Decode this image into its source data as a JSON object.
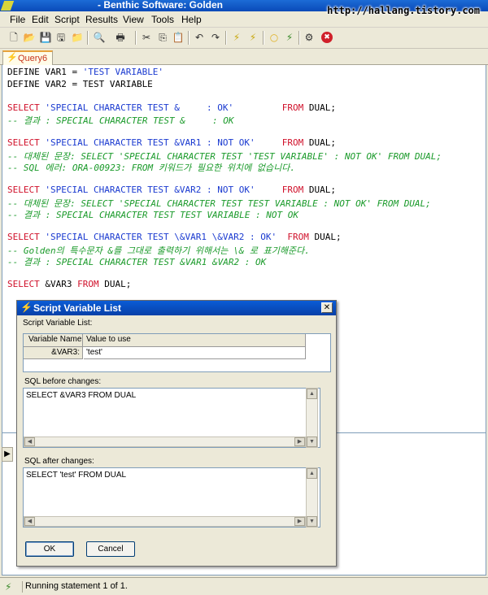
{
  "window": {
    "title": "- Benthic Software: Golden"
  },
  "watermark": "http://hallang.tistory.com",
  "menu": [
    "File",
    "Edit",
    "Script",
    "Results",
    "View",
    "Tools",
    "Help"
  ],
  "toolbar": {
    "buttons": [
      {
        "name": "new-icon",
        "glyph": "🗋"
      },
      {
        "name": "open-icon",
        "glyph": "📂"
      },
      {
        "name": "save-icon",
        "glyph": "💾"
      },
      {
        "name": "save-all-icon",
        "glyph": "🖫"
      },
      {
        "name": "open-folder-icon",
        "glyph": "📁"
      },
      {
        "name": "print-preview-icon",
        "glyph": "🔍"
      },
      {
        "name": "print-icon",
        "glyph": "🖶"
      },
      {
        "name": "cut-icon",
        "glyph": "✂"
      },
      {
        "name": "copy-icon",
        "glyph": "⎘"
      },
      {
        "name": "paste-icon",
        "glyph": "📋"
      },
      {
        "name": "undo-icon",
        "glyph": "↶"
      },
      {
        "name": "redo-icon",
        "glyph": "↷"
      },
      {
        "name": "execute-icon",
        "glyph": "⚡"
      },
      {
        "name": "execute-step-icon",
        "glyph": "⚡"
      },
      {
        "name": "commit-icon",
        "glyph": "○"
      },
      {
        "name": "rollback-icon",
        "glyph": "⚡"
      },
      {
        "name": "settings-icon",
        "glyph": "⚙"
      },
      {
        "name": "stop-icon",
        "glyph": "✖"
      }
    ],
    "colors": {
      "stop": "#d0202a",
      "run": "#d8c020",
      "commit": "#e0b020"
    }
  },
  "tab": {
    "label": "Query6"
  },
  "editor": {
    "lines": [
      [
        {
          "t": "DEFINE VAR1 = ",
          "c": ""
        },
        {
          "t": "'TEST VARIABLE'",
          "c": "str"
        }
      ],
      [
        {
          "t": "DEFINE VAR2 = TEST VARIABLE",
          "c": ""
        }
      ],
      [],
      [
        {
          "t": "SELECT ",
          "c": "kw"
        },
        {
          "t": "'SPECIAL CHARACTER TEST &     : OK'",
          "c": "str"
        },
        {
          "t": "         ",
          "c": ""
        },
        {
          "t": "FROM",
          "c": "kw"
        },
        {
          "t": " DUAL;",
          "c": ""
        }
      ],
      [
        {
          "t": "-- 결과 : SPECIAL CHARACTER TEST &     : OK",
          "c": "cmt"
        }
      ],
      [],
      [
        {
          "t": "SELECT ",
          "c": "kw"
        },
        {
          "t": "'SPECIAL CHARACTER TEST &VAR1 : NOT OK'",
          "c": "str"
        },
        {
          "t": "     ",
          "c": ""
        },
        {
          "t": "FROM",
          "c": "kw"
        },
        {
          "t": " DUAL;",
          "c": ""
        }
      ],
      [
        {
          "t": "-- 대체된 문장: SELECT 'SPECIAL CHARACTER TEST 'TEST VARIABLE' : NOT OK' FROM DUAL;",
          "c": "cmt"
        }
      ],
      [
        {
          "t": "-- SQL 에러: ORA-00923: FROM 키워드가 필요한 위치에 없습니다.",
          "c": "cmt"
        }
      ],
      [],
      [
        {
          "t": "SELECT ",
          "c": "kw"
        },
        {
          "t": "'SPECIAL CHARACTER TEST &VAR2 : NOT OK'",
          "c": "str"
        },
        {
          "t": "     ",
          "c": ""
        },
        {
          "t": "FROM",
          "c": "kw"
        },
        {
          "t": " DUAL;",
          "c": ""
        }
      ],
      [
        {
          "t": "-- 대체된 문장: SELECT 'SPECIAL CHARACTER TEST TEST VARIABLE : NOT OK' FROM DUAL;",
          "c": "cmt"
        }
      ],
      [
        {
          "t": "-- 결과 : SPECIAL CHARACTER TEST TEST VARIABLE : NOT OK",
          "c": "cmt"
        }
      ],
      [],
      [
        {
          "t": "SELECT ",
          "c": "kw"
        },
        {
          "t": "'SPECIAL CHARACTER TEST \\&VAR1 \\&VAR2 : OK'",
          "c": "str"
        },
        {
          "t": "  ",
          "c": ""
        },
        {
          "t": "FROM",
          "c": "kw"
        },
        {
          "t": " DUAL;",
          "c": ""
        }
      ],
      [
        {
          "t": "-- Golden의 특수문자 &를 그대로 출력하기 위해서는 \\& 로 표기해준다.",
          "c": "cmt"
        }
      ],
      [
        {
          "t": "-- 결과 : SPECIAL CHARACTER TEST &VAR1 &VAR2 : OK",
          "c": "cmt"
        }
      ],
      [],
      [
        {
          "t": "SELECT ",
          "c": "kw"
        },
        {
          "t": "&VAR3 ",
          "c": ""
        },
        {
          "t": "FROM",
          "c": "kw"
        },
        {
          "t": " DUAL;",
          "c": ""
        }
      ]
    ]
  },
  "dialog": {
    "title": "Script Variable List",
    "section_label": "Script Variable List:",
    "col_name": "Variable Name",
    "col_value": "Value to use",
    "var_name": "&VAR3:",
    "var_value": "'test'",
    "before_label": "SQL before changes:",
    "before_sql": "SELECT &VAR3 FROM DUAL",
    "after_label": "SQL after changes:",
    "after_sql": "SELECT 'test' FROM DUAL",
    "ok": "OK",
    "cancel": "Cancel"
  },
  "status": {
    "text": "Running statement 1 of 1."
  }
}
